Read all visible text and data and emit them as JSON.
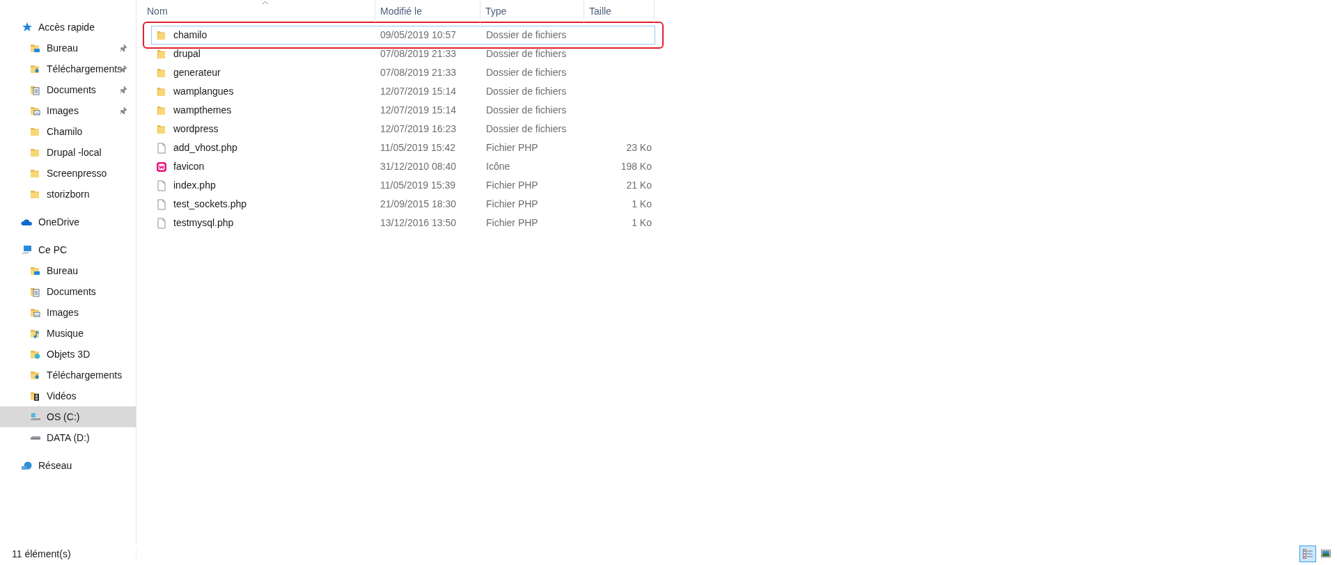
{
  "sidebar": {
    "sections": [
      {
        "label": "Accès rapide",
        "kind": "star",
        "selected": false,
        "children": [
          {
            "label": "Bureau",
            "kind": "desktop",
            "pinned": true,
            "selected": false
          },
          {
            "label": "Téléchargements",
            "kind": "downloads",
            "pinned": true,
            "selected": false
          },
          {
            "label": "Documents",
            "kind": "documents",
            "pinned": true,
            "selected": false
          },
          {
            "label": "Images",
            "kind": "pictures",
            "pinned": true,
            "selected": false
          },
          {
            "label": "Chamilo",
            "kind": "folder",
            "pinned": false,
            "selected": false
          },
          {
            "label": "Drupal -local",
            "kind": "folder",
            "pinned": false,
            "selected": false
          },
          {
            "label": "Screenpresso",
            "kind": "folder",
            "pinned": false,
            "selected": false
          },
          {
            "label": "storizborn",
            "kind": "folder",
            "pinned": false,
            "selected": false
          }
        ]
      },
      {
        "label": "OneDrive",
        "kind": "cloud",
        "selected": false
      },
      {
        "label": "Ce PC",
        "kind": "pc",
        "selected": false,
        "children": [
          {
            "label": "Bureau",
            "kind": "desktop",
            "pinned": false,
            "selected": false
          },
          {
            "label": "Documents",
            "kind": "documents",
            "pinned": false,
            "selected": false
          },
          {
            "label": "Images",
            "kind": "pictures",
            "pinned": false,
            "selected": false
          },
          {
            "label": "Musique",
            "kind": "music",
            "pinned": false,
            "selected": false
          },
          {
            "label": "Objets 3D",
            "kind": "objects",
            "pinned": false,
            "selected": false
          },
          {
            "label": "Téléchargements",
            "kind": "downloads",
            "pinned": false,
            "selected": false
          },
          {
            "label": "Vidéos",
            "kind": "videos",
            "pinned": false,
            "selected": false
          },
          {
            "label": "OS (C:)",
            "kind": "osdrive",
            "pinned": false,
            "selected": true
          },
          {
            "label": "DATA (D:)",
            "kind": "drive",
            "pinned": false,
            "selected": false
          }
        ]
      },
      {
        "label": "Réseau",
        "kind": "network",
        "selected": false
      }
    ]
  },
  "table": {
    "columns": [
      "Nom",
      "Modifié le",
      "Type",
      "Taille"
    ],
    "rows": [
      {
        "kind": "folder",
        "name": "chamilo",
        "modified": "09/05/2019 10:57",
        "type": "Dossier de fichiers",
        "focused": true,
        "highlighted": true
      },
      {
        "kind": "folder",
        "name": "drupal",
        "modified": "07/08/2019 21:33",
        "type": "Dossier de fichiers",
        "focused": false,
        "highlighted": false
      },
      {
        "kind": "folder",
        "name": "generateur",
        "modified": "07/08/2019 21:33",
        "type": "Dossier de fichiers",
        "focused": false,
        "highlighted": false
      },
      {
        "kind": "folder",
        "name": "wamplangues",
        "modified": "12/07/2019 15:14",
        "type": "Dossier de fichiers",
        "focused": false,
        "highlighted": false
      },
      {
        "kind": "folder",
        "name": "wampthemes",
        "modified": "12/07/2019 15:14",
        "type": "Dossier de fichiers",
        "focused": false,
        "highlighted": false
      },
      {
        "kind": "folder",
        "name": "wordpress",
        "modified": "12/07/2019 16:23",
        "type": "Dossier de fichiers",
        "focused": false,
        "highlighted": false
      },
      {
        "kind": "file",
        "name": "add_vhost.php",
        "modified": "11/05/2019 15:42",
        "type": "Fichier PHP",
        "size": "23 Ko",
        "focused": false,
        "highlighted": false
      },
      {
        "kind": "icon",
        "name": "favicon",
        "modified": "31/12/2010 08:40",
        "type": "Icône",
        "size": "198 Ko",
        "focused": false,
        "highlighted": false
      },
      {
        "kind": "file",
        "name": "index.php",
        "modified": "11/05/2019 15:39",
        "type": "Fichier PHP",
        "size": "21 Ko",
        "focused": false,
        "highlighted": false
      },
      {
        "kind": "file",
        "name": "test_sockets.php",
        "modified": "21/09/2015 18:30",
        "type": "Fichier PHP",
        "size": "1 Ko",
        "focused": false,
        "highlighted": false
      },
      {
        "kind": "file",
        "name": "testmysql.php",
        "modified": "13/12/2016 13:50",
        "type": "Fichier PHP",
        "size": "1 Ko",
        "focused": false,
        "highlighted": false
      }
    ]
  },
  "status_bar": {
    "count": "11 élément(s)",
    "view_buttons": [
      {
        "kind": "details",
        "selected": true
      },
      {
        "kind": "preview",
        "selected": false
      }
    ]
  }
}
